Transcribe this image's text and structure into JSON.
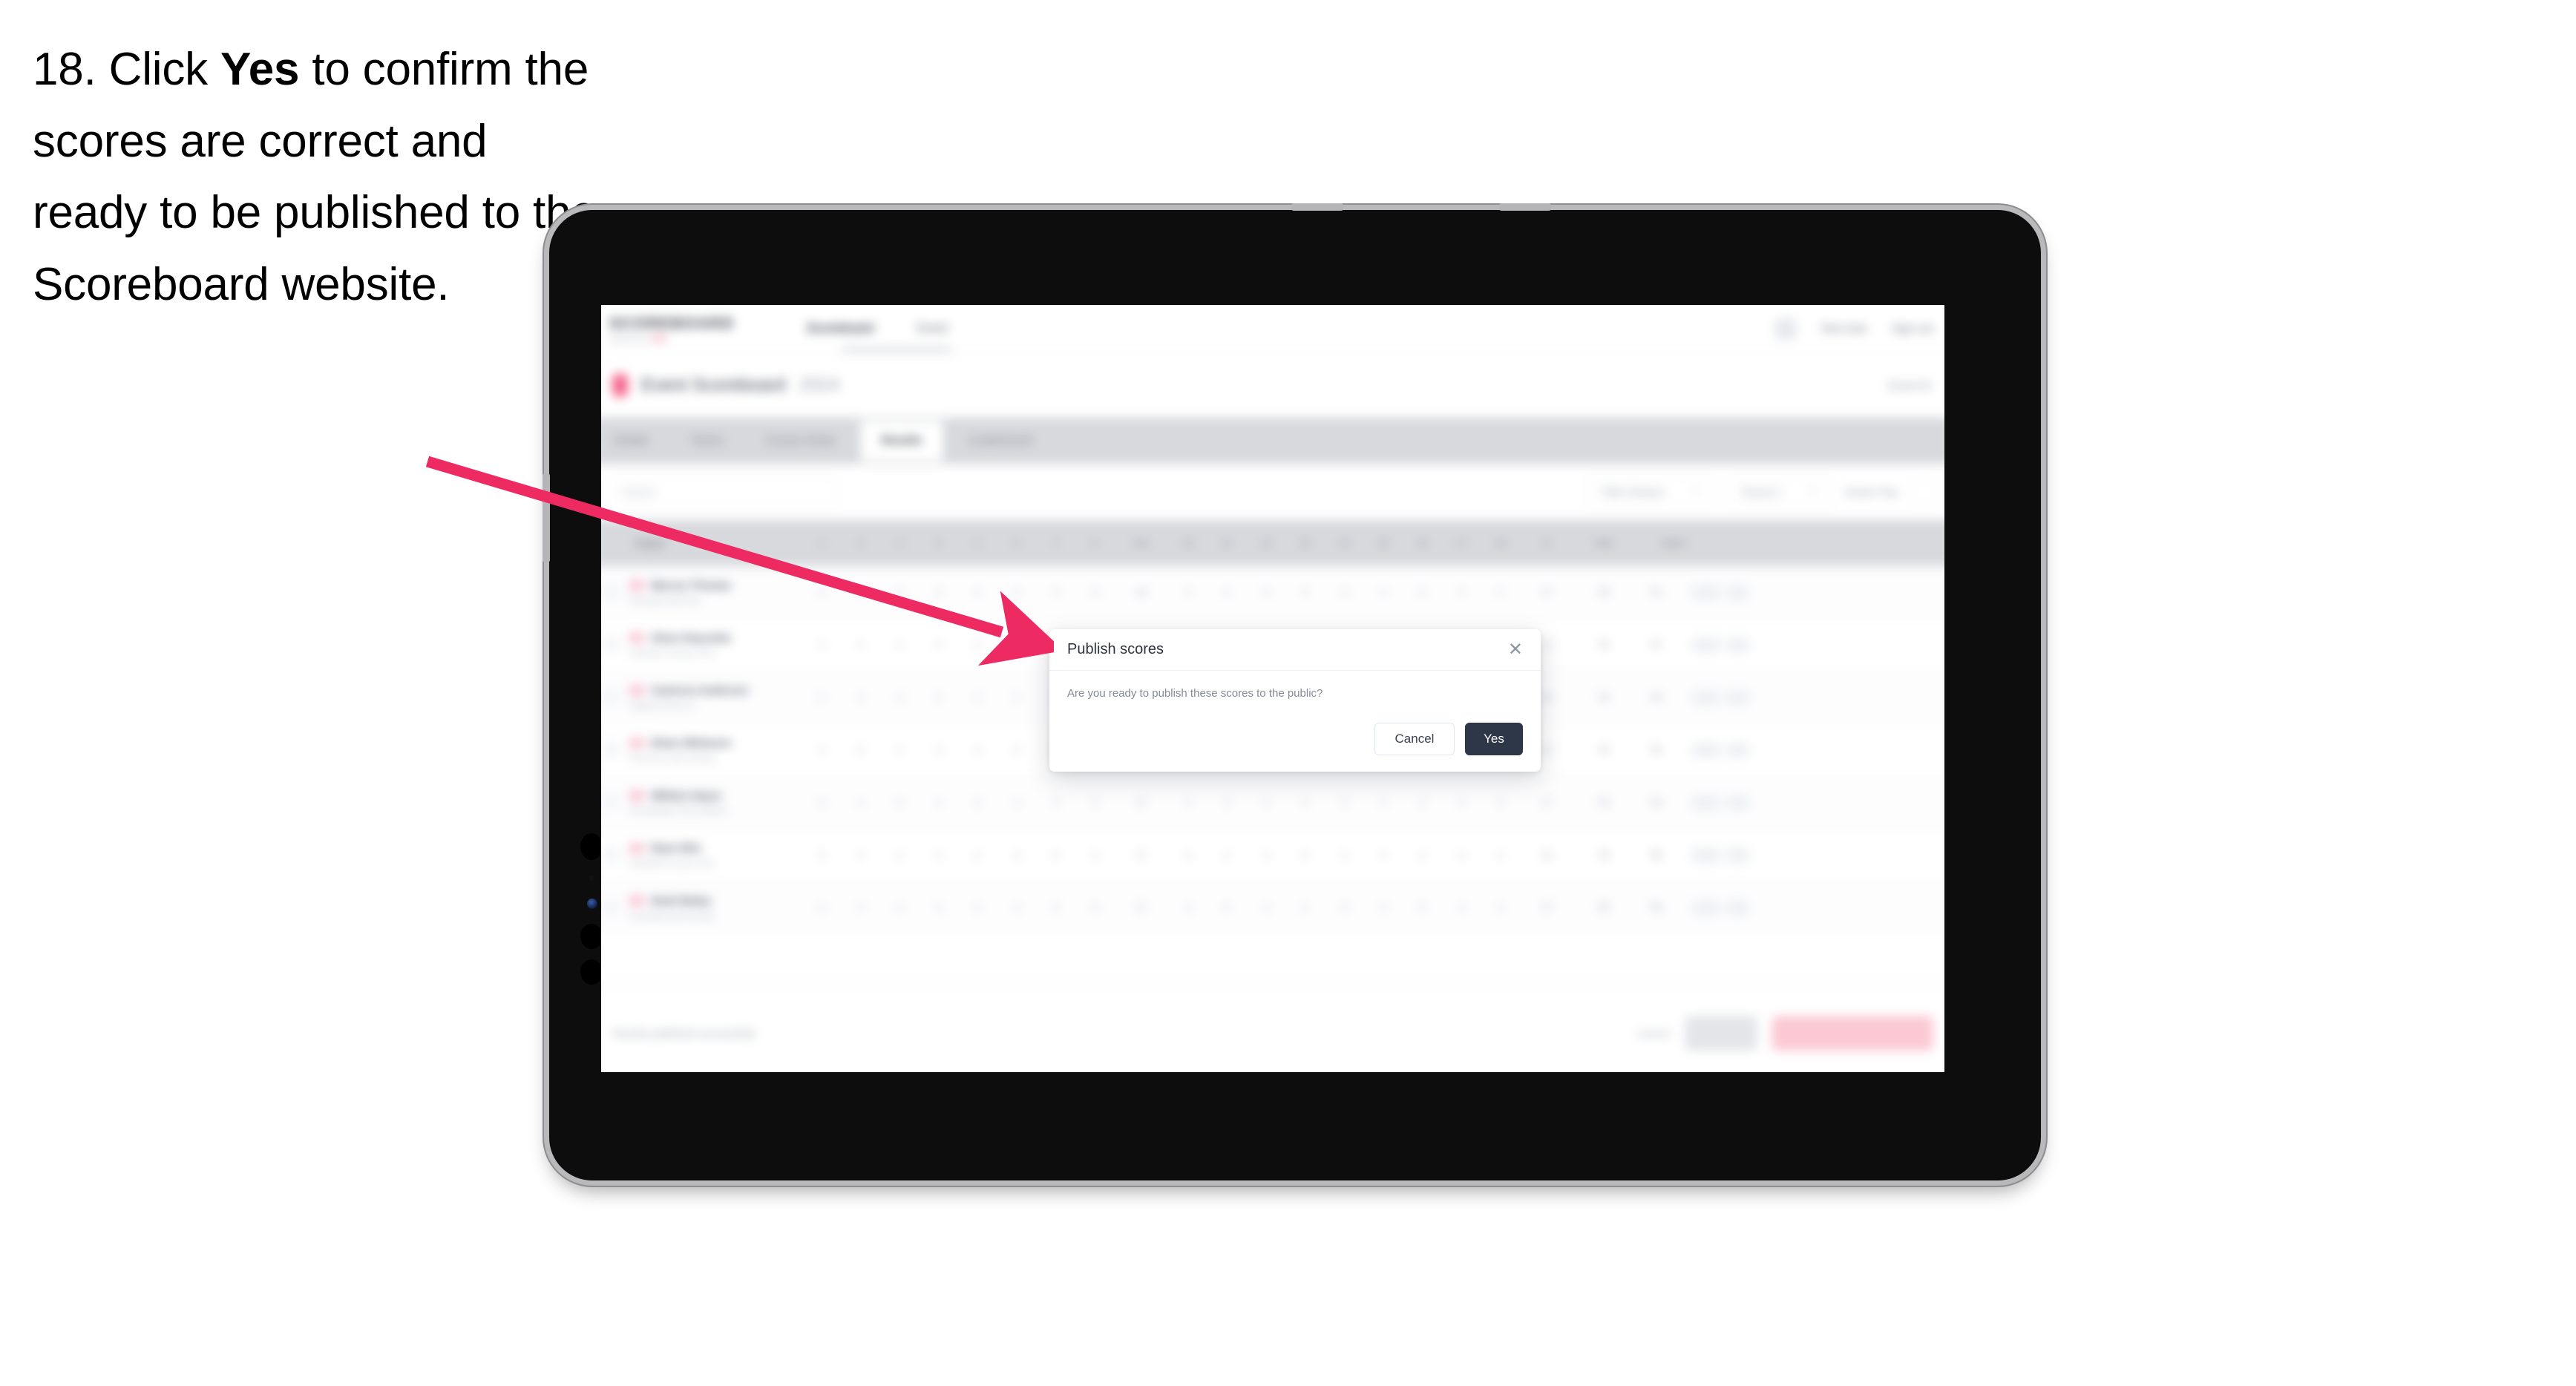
{
  "caption": {
    "step_number": "18.",
    "text_before": "Click",
    "emphasis": "Yes",
    "text_after": "to confirm the scores are correct and ready to be published to the Scoreboard website.",
    "full": "18. Click Yes to confirm the scores are correct and ready to be published to the Scoreboard website."
  },
  "annotation": {
    "arrow_color": "#ee2a62",
    "arrow_name": "pointer-arrow-to-yes-button"
  },
  "device": {
    "type": "tablet",
    "body_color": "#0d0d0d",
    "bezel_color": "#b9b9bb"
  },
  "app": {
    "nav": {
      "brand": "SCOREBOARD",
      "brand_sub_left": "powered by",
      "brand_sub_mark": "SSE",
      "links": [
        {
          "label": "Scoreboard",
          "selected": true
        },
        {
          "label": "Event",
          "selected": false
        }
      ],
      "user": "Test User",
      "signout": "Sign out"
    },
    "page": {
      "title": "Event Scoreboard",
      "title_muted": "2024",
      "right_label": "Event ID"
    },
    "tabs": [
      {
        "label": "Details",
        "active": false
      },
      {
        "label": "Teams",
        "active": false
      },
      {
        "label": "Course Setup",
        "active": false
      },
      {
        "label": "Results",
        "active": true
      },
      {
        "label": "Leaderboard",
        "active": false
      }
    ],
    "toolbar": {
      "search_placeholder": "Search",
      "filter_one": "Filter Division",
      "filter_two": "Round 1",
      "filter_three": "Stroke Play",
      "icon_button": "settings-icon"
    },
    "table": {
      "columns": [
        "Player",
        "1",
        "2",
        "3",
        "4",
        "5",
        "6",
        "7",
        "8",
        "Out",
        "10",
        "11",
        "12",
        "13",
        "14",
        "15",
        "16",
        "17",
        "18",
        "In",
        "Total",
        "Status"
      ],
      "rows": [
        {
          "player": "Marcus Thomas",
          "club": "Riverside Golf Club",
          "holes": [
            "4",
            "5",
            "3",
            "4",
            "4",
            "5",
            "4",
            "3",
            "36",
            "4",
            "4",
            "5",
            "3",
            "4",
            "4",
            "5",
            "4",
            "4",
            "37"
          ],
          "total": "73",
          "position": "T1"
        },
        {
          "player": "Oliver Reynolds",
          "club": "Lakeview Country Club",
          "holes": [
            "4",
            "4",
            "4",
            "5",
            "3",
            "4",
            "4",
            "4",
            "36",
            "5",
            "4",
            "4",
            "4",
            "3",
            "5",
            "4",
            "4",
            "4",
            "37"
          ],
          "total": "73",
          "position": "T1"
        },
        {
          "player": "Cameron Anderson",
          "club": "Highland Park GC",
          "holes": [
            "5",
            "4",
            "3",
            "4",
            "4",
            "4",
            "5",
            "4",
            "37",
            "4",
            "5",
            "4",
            "3",
            "4",
            "4",
            "4",
            "5",
            "3",
            "36"
          ],
          "total": "73",
          "position": "T3"
        },
        {
          "player": "Ethan Whitmore",
          "club": "Pinehurst Links Society",
          "holes": [
            "4",
            "5",
            "4",
            "3",
            "4",
            "5",
            "4",
            "4",
            "37",
            "4",
            "4",
            "3",
            "5",
            "4",
            "4",
            "5",
            "4",
            "4",
            "37"
          ],
          "total": "74",
          "position": "T4"
        },
        {
          "player": "William Hayes",
          "club": "Stonebridge Golf Academy",
          "holes": [
            "4",
            "4",
            "5",
            "4",
            "3",
            "4",
            "4",
            "5",
            "37",
            "4",
            "3",
            "4",
            "4",
            "5",
            "4",
            "4",
            "4",
            "5",
            "37"
          ],
          "total": "74",
          "position": "T4"
        },
        {
          "player": "Ryan Ellis",
          "club": "Westfield Country Club",
          "holes": [
            "5",
            "4",
            "4",
            "4",
            "4",
            "3",
            "5",
            "4",
            "37",
            "3",
            "4",
            "4",
            "5",
            "4",
            "4",
            "4",
            "4",
            "4",
            "36"
          ],
          "total": "75",
          "position": "T6"
        },
        {
          "player": "Noah Bailey",
          "club": "Greenfield Golf Society",
          "holes": [
            "4",
            "4",
            "4",
            "5",
            "4",
            "4",
            "3",
            "5",
            "37",
            "4",
            "5",
            "4",
            "4",
            "3",
            "4",
            "5",
            "4",
            "4",
            "37"
          ],
          "total": "75",
          "position": "T6"
        }
      ]
    },
    "footer": {
      "note": "Results published successfully",
      "cancel_link": "Cancel",
      "save_button": "Save",
      "publish_button": "Publish to Scoreboard"
    }
  },
  "modal": {
    "title": "Publish scores",
    "close_icon": "close-icon",
    "message": "Are you ready to publish these scores to the public?",
    "cancel_label": "Cancel",
    "confirm_label": "Yes",
    "confirm_bg": "#2e3748",
    "cancel_border": "#dfe6f5"
  }
}
